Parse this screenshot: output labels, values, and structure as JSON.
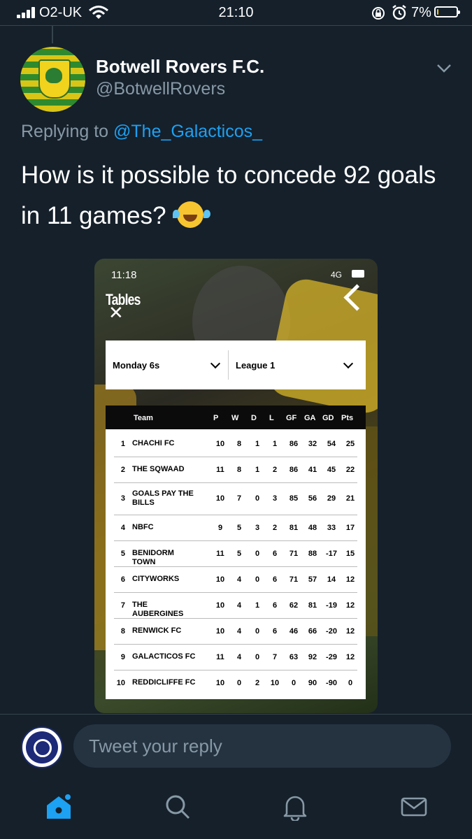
{
  "status_bar": {
    "carrier": "O2-UK",
    "time": "21:10",
    "battery_percent": "7%",
    "battery_level": 0.07,
    "icons": [
      "signal-icon",
      "wifi-icon",
      "orientation-lock-icon",
      "alarm-icon",
      "battery-icon"
    ]
  },
  "tweet": {
    "author_name": "Botwell Rovers F.C.",
    "author_handle": "@BotwellRovers",
    "replying_to_prefix": "Replying to ",
    "replying_to_handle": "@The_Galacticos_",
    "text": "How is it possible to concede 92 goals in 11 games?",
    "emoji": "face-with-tears-of-joy"
  },
  "media": {
    "time": "11:18",
    "network": "4G",
    "title": "Tables",
    "filters": [
      "Monday 6s",
      "League 1"
    ],
    "table_columns": [
      "Team",
      "P",
      "W",
      "D",
      "L",
      "GF",
      "GA",
      "GD",
      "Pts"
    ],
    "table_rows": [
      [
        "1",
        "CHACHI FC",
        "10",
        "8",
        "1",
        "1",
        "86",
        "32",
        "54",
        "25"
      ],
      [
        "2",
        "THE SQWAAD",
        "11",
        "8",
        "1",
        "2",
        "86",
        "41",
        "45",
        "22"
      ],
      [
        "3",
        "GOALS PAY THE BILLS",
        "10",
        "7",
        "0",
        "3",
        "85",
        "56",
        "29",
        "21"
      ],
      [
        "4",
        "NBFC",
        "9",
        "5",
        "3",
        "2",
        "81",
        "48",
        "33",
        "17"
      ],
      [
        "5",
        "BENIDORM TOWN",
        "11",
        "5",
        "0",
        "6",
        "71",
        "88",
        "-17",
        "15"
      ],
      [
        "6",
        "CITYWORKS",
        "10",
        "4",
        "0",
        "6",
        "71",
        "57",
        "14",
        "12"
      ],
      [
        "7",
        "THE AUBERGINES",
        "10",
        "4",
        "1",
        "6",
        "62",
        "81",
        "-19",
        "12"
      ],
      [
        "8",
        "RENWICK FC",
        "10",
        "4",
        "0",
        "6",
        "46",
        "66",
        "-20",
        "12"
      ],
      [
        "9",
        "GALACTICOS FC",
        "11",
        "4",
        "0",
        "7",
        "63",
        "92",
        "-29",
        "12"
      ],
      [
        "10",
        "REDDICLIFFE FC",
        "10",
        "0",
        "2",
        "10",
        "0",
        "90",
        "-90",
        "0"
      ]
    ]
  },
  "reply": {
    "avatar_text": "THE GALACTICOS F.C",
    "placeholder": "Tweet your reply"
  },
  "tabbar": {
    "items": [
      "home-icon",
      "search-icon",
      "notifications-icon",
      "messages-icon"
    ],
    "accent_color": "#1da1f2"
  },
  "colors": {
    "background": "#15202b",
    "secondary_text": "#8899a6",
    "link": "#1da1f2"
  }
}
